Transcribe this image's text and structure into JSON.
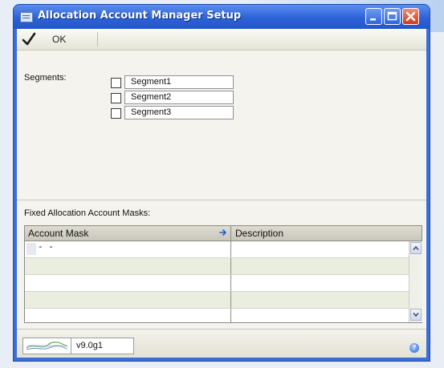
{
  "window": {
    "title": "Allocation Account Manager Setup"
  },
  "toolbar": {
    "ok_label": "OK"
  },
  "segments": {
    "label": "Segments:",
    "items": [
      {
        "label": "Segment1",
        "checked": false
      },
      {
        "label": "Segment2",
        "checked": false
      },
      {
        "label": "Segment3",
        "checked": false
      }
    ]
  },
  "masks": {
    "label": "Fixed Allocation Account Masks:",
    "columns": [
      "Account Mask",
      "Description"
    ],
    "rows": [
      {
        "mask": "-   -",
        "description": ""
      },
      {
        "mask": "",
        "description": ""
      },
      {
        "mask": "",
        "description": ""
      },
      {
        "mask": "",
        "description": ""
      },
      {
        "mask": "",
        "description": ""
      }
    ]
  },
  "status": {
    "version": "v9.0g1",
    "help_icon": "help-icon",
    "logo": "vendor-logo"
  },
  "colors": {
    "titlebar": "#2d62d8",
    "close_button": "#d2391b",
    "alt_row": "#eaeedf",
    "panel": "#f4f3ee"
  }
}
